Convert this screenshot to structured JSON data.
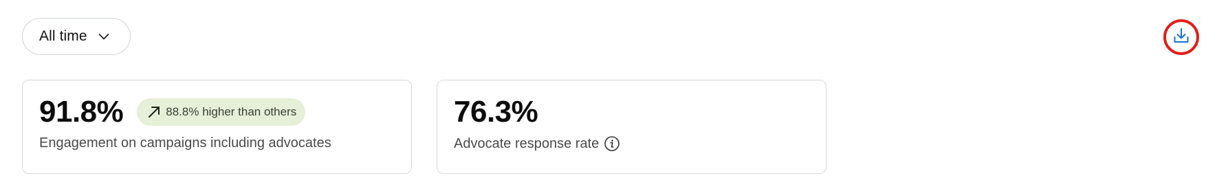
{
  "filters": {
    "time_range": {
      "selected": "All time",
      "icon": "chevron-down-icon"
    }
  },
  "toolbar": {
    "download_icon": "download-icon",
    "accent_color": "#1a6fd0",
    "highlight_color": "#e0201b"
  },
  "metrics": [
    {
      "value": "91.8%",
      "label": "Engagement on campaigns including advocates",
      "badge": {
        "text": "88.8% higher than others",
        "icon": "trend-up-arrow-icon",
        "background": "#e6efd7"
      }
    },
    {
      "value": "76.3%",
      "label": "Advocate response rate",
      "info_icon": "info-icon"
    }
  ]
}
